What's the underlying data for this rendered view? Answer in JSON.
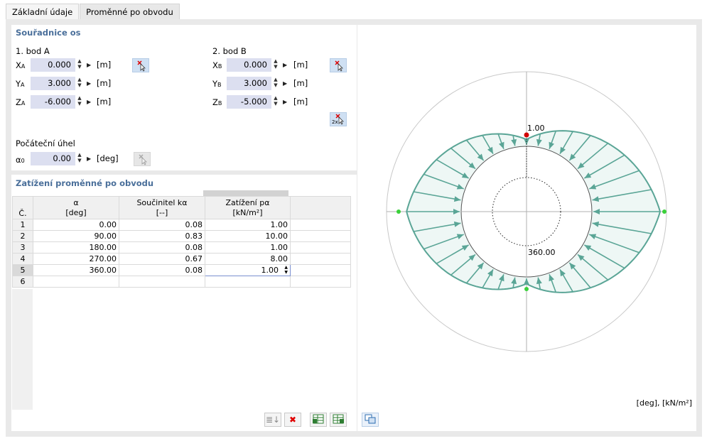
{
  "tabs": [
    {
      "label": "Základní údaje"
    },
    {
      "label": "Proměnné po obvodu"
    }
  ],
  "axes_section": {
    "title": "Souřadnice os",
    "point_a": {
      "title": "1. bod A",
      "rows": [
        {
          "label": "X",
          "sub": "A",
          "value": "0.000",
          "unit": "[m]"
        },
        {
          "label": "Y",
          "sub": "A",
          "value": "3.000",
          "unit": "[m]"
        },
        {
          "label": "Z",
          "sub": "A",
          "value": "-6.000",
          "unit": "[m]"
        }
      ]
    },
    "point_b": {
      "title": "2. bod B",
      "rows": [
        {
          "label": "X",
          "sub": "B",
          "value": "0.000",
          "unit": "[m]"
        },
        {
          "label": "Y",
          "sub": "B",
          "value": "3.000",
          "unit": "[m]"
        },
        {
          "label": "Z",
          "sub": "B",
          "value": "-5.000",
          "unit": "[m]"
        }
      ]
    },
    "pick_two_label": "2x",
    "start_angle": {
      "title": "Počáteční úhel",
      "label": "α",
      "sub": "0",
      "value": "0.00",
      "unit": "[deg]"
    }
  },
  "load_section": {
    "title": "Zatížení proměnné po obvodu",
    "columns": [
      {
        "top": "",
        "bottom": "Č."
      },
      {
        "top": "α",
        "bottom": "[deg]"
      },
      {
        "top": "Součinitel kα",
        "bottom": "[--]"
      },
      {
        "top": "Zatížení pα",
        "bottom": "[kN/m²]"
      }
    ],
    "rows": [
      {
        "no": "1",
        "alpha": "0.00",
        "k": "0.08",
        "p": "1.00"
      },
      {
        "no": "2",
        "alpha": "90.00",
        "k": "0.83",
        "p": "10.00"
      },
      {
        "no": "3",
        "alpha": "180.00",
        "k": "0.08",
        "p": "1.00"
      },
      {
        "no": "4",
        "alpha": "270.00",
        "k": "0.67",
        "p": "8.00"
      },
      {
        "no": "5",
        "alpha": "360.00",
        "k": "0.08",
        "p": "1.00"
      },
      {
        "no": "6",
        "alpha": "",
        "k": "",
        "p": ""
      }
    ]
  },
  "diagram": {
    "label_top": "1.00",
    "label_bottom": "360.00",
    "units": "[deg], [kN/m²]",
    "colors": {
      "load": "#5aa596",
      "fill": "#eef7f5",
      "marker_top": "#d00000",
      "marker_side": "#3ad13a"
    }
  },
  "icons": {
    "pick": "pick-point-icon",
    "sort": "sort-icon",
    "delete": "delete-icon",
    "import": "import-table-icon",
    "export": "export-table-icon",
    "view": "diagram-view-icon"
  }
}
